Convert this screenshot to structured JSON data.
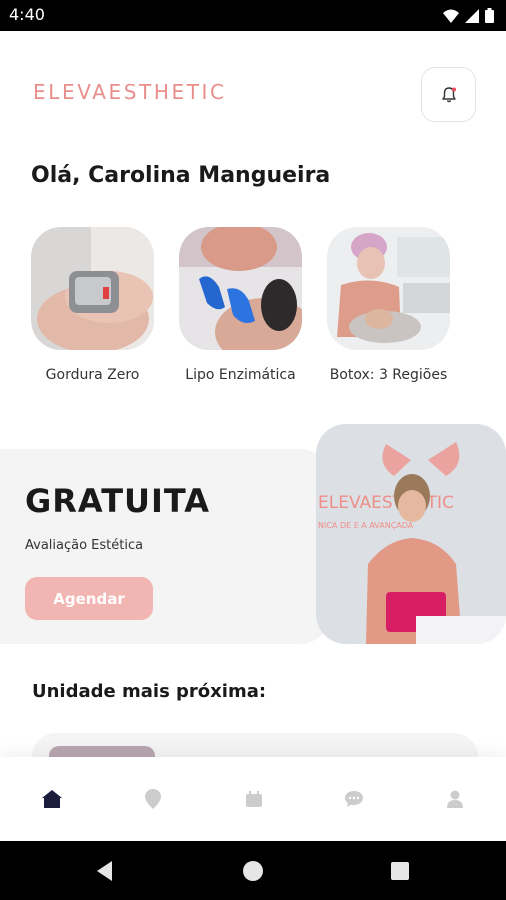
{
  "status_bar": {
    "time": "4:40"
  },
  "header": {
    "logo": "ELEVAESTHETIC"
  },
  "greeting": "Olá, Carolina Mangueira",
  "services": [
    {
      "label": "Gordura Zero"
    },
    {
      "label": "Lipo Enzimática"
    },
    {
      "label": "Botox: 3 Regiões"
    }
  ],
  "promo": {
    "title": "GRATUITA",
    "subtitle": "Avaliação Estética",
    "button": "Agendar",
    "photo_sign": "ELEVAESTHETIC",
    "photo_sign_sub": "NICA DE E    A AVANÇADA"
  },
  "nearest_unit": {
    "title": "Unidade mais próxima:"
  },
  "bottom_nav": [
    "home",
    "location",
    "calendar",
    "chat",
    "profile"
  ],
  "colors": {
    "brand": "#e88f8c",
    "button": "#f2b6b2",
    "nav_active": "#1c1d3a",
    "nav_inactive": "#cccccc"
  }
}
